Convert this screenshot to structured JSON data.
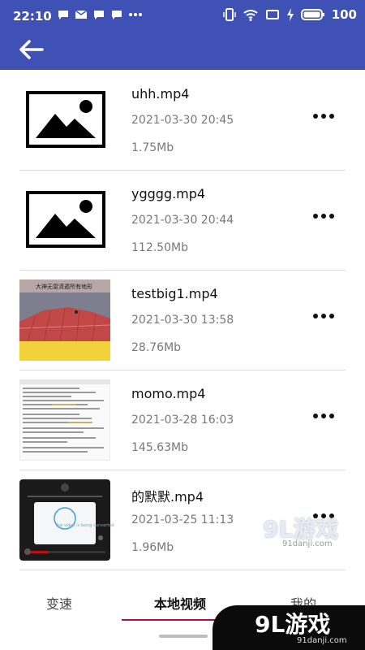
{
  "status_bar": {
    "time": "22:10",
    "battery_text": "100",
    "left_icons": [
      "message-icon",
      "mail-icon",
      "message-icon",
      "message-icon",
      "more-dots-icon"
    ],
    "right_icons": [
      "vibrate-icon",
      "wifi-icon",
      "screen-rotate-icon",
      "charging-icon",
      "battery-icon"
    ]
  },
  "app_bar": {
    "back_icon": "arrow-left-icon",
    "color": "#3F51B5"
  },
  "videos": [
    {
      "name": "uhh.mp4",
      "date": "2021-03-30 20:45",
      "size": "1.75Mb",
      "thumb": "image-placeholder"
    },
    {
      "name": "ygggg.mp4",
      "date": "2021-03-30 20:44",
      "size": "112.50Mb",
      "thumb": "image-placeholder"
    },
    {
      "name": "testbig1.mp4",
      "date": "2021-03-30 13:58",
      "size": "28.76Mb",
      "thumb": "video-frame",
      "thumb_caption": "大神无雷清遁所有地形"
    },
    {
      "name": "momo.mp4",
      "date": "2021-03-28 16:03",
      "size": "145.63Mb",
      "thumb": "code-screenshot"
    },
    {
      "name": "的默默.mp4",
      "date": "2021-03-25 11:13",
      "size": "1.96Mb",
      "thumb": "dark-player",
      "thumb_caption": "The video is being converted"
    }
  ],
  "bottom_nav": {
    "tabs": [
      {
        "label": "变速"
      },
      {
        "label": "本地视频"
      },
      {
        "label": "我的"
      }
    ],
    "accent": "#B0123D"
  },
  "watermark": {
    "logo": "9L游戏",
    "logo_small": "9L游戏",
    "url": "91danji.com"
  }
}
